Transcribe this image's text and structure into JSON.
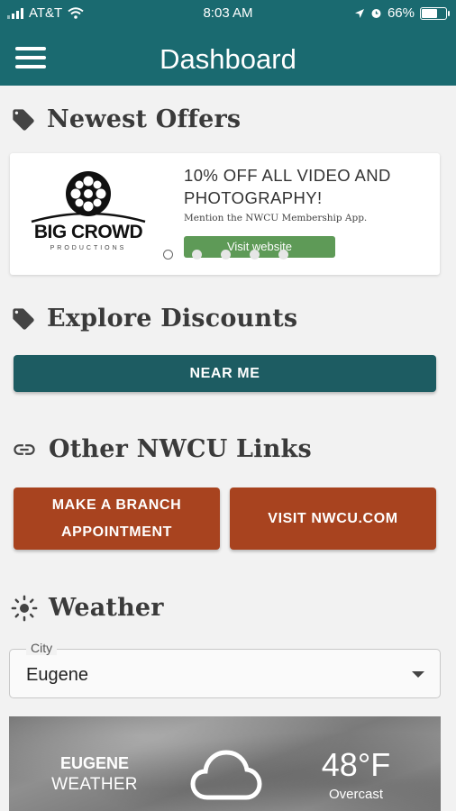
{
  "status_bar": {
    "carrier": "AT&T",
    "time": "8:03 AM",
    "battery": "66%",
    "battery_fraction": 0.66
  },
  "app_bar": {
    "title": "Dashboard",
    "menu_icon": "hamburger-menu-icon"
  },
  "offers": {
    "title": "Newest Offers",
    "icon": "tag-icon",
    "card": {
      "brand": "BIG CROWD",
      "brand_sub": "PRODUCTIONS",
      "headline": "10% OFF ALL VIDEO AND PHOTOGRAPHY!",
      "subtext": "Mention the NWCU Membership App.",
      "button": "Visit website"
    },
    "carousel": {
      "count": 5,
      "active": 1
    }
  },
  "discounts": {
    "title": "Explore Discounts",
    "icon": "tag-icon",
    "button": "NEAR ME"
  },
  "links": {
    "title": "Other NWCU Links",
    "icon": "link-icon",
    "buttons": [
      "MAKE A BRANCH APPOINTMENT",
      "VISIT NWCU.COM"
    ]
  },
  "weather": {
    "title": "Weather",
    "icon": "sun-icon",
    "city_label": "City",
    "city_value": "Eugene",
    "card": {
      "city": "EUGENE",
      "label": "WEATHER",
      "temp": "48°F",
      "condition": "Overcast",
      "condition_icon": "cloud-icon"
    }
  },
  "colors": {
    "primary": "#1a6a70",
    "button_teal": "#1d5c62",
    "button_orange": "#a8431f",
    "button_green": "#5e9a57"
  }
}
